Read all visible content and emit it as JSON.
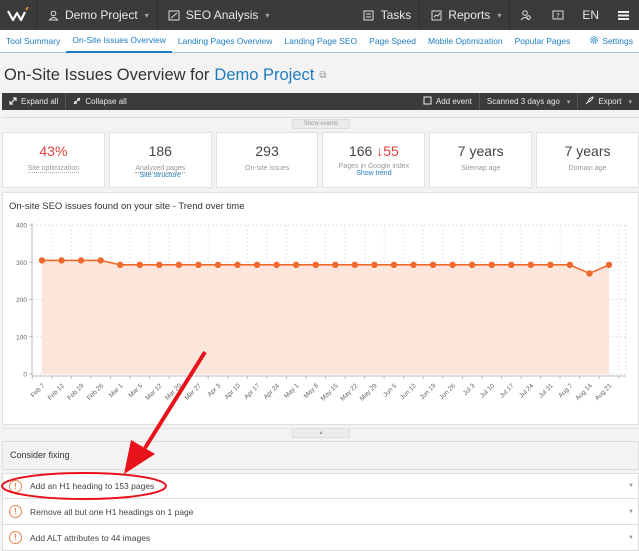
{
  "topbar": {
    "project": "Demo Project",
    "module": "SEO Analysis",
    "tasks": "Tasks",
    "reports": "Reports",
    "language": "EN"
  },
  "subnav": {
    "tabs": [
      {
        "label": "Tool Summary"
      },
      {
        "label": "On-Site Issues Overview"
      },
      {
        "label": "Landing Pages Overview"
      },
      {
        "label": "Landing Page SEO"
      },
      {
        "label": "Page Speed"
      },
      {
        "label": "Mobile Optimization"
      },
      {
        "label": "Popular Pages"
      }
    ],
    "active_index": 1,
    "settings": "Settings"
  },
  "page": {
    "title_prefix": "On-Site Issues Overview for",
    "project_link": "Demo Project"
  },
  "toolbar": {
    "expand_all": "Expand all",
    "collapse_all": "Collapse all",
    "add_event": "Add event",
    "scanned": "Scanned 3 days ago",
    "export": "Export"
  },
  "show_events": "Show events",
  "cards": [
    {
      "value": "43%",
      "label": "Site optimization"
    },
    {
      "value": "186",
      "label": "Analyzed pages",
      "link": "Site structure"
    },
    {
      "value": "293",
      "label": "On-site issues"
    },
    {
      "value": "166",
      "delta": "55",
      "label": "Pages in Google index",
      "link": "Show trend"
    },
    {
      "value": "7 years",
      "label": "Sitemap age"
    },
    {
      "value": "7 years",
      "label": "Domain age"
    }
  ],
  "chart_data": {
    "type": "area",
    "title": "On-site SEO issues found on your site - Trend over time",
    "xlabel": "",
    "ylabel": "",
    "ylim": [
      0,
      400
    ],
    "yticks": [
      0,
      100,
      200,
      300,
      400
    ],
    "grid": true,
    "x": [
      "Feb 7",
      "Feb 12",
      "Feb 19",
      "Feb 26",
      "Mar 1",
      "Mar 5",
      "Mar 12",
      "Mar 20",
      "Mar 27",
      "Apr 3",
      "Apr 10",
      "Apr 17",
      "Apr 24",
      "May 1",
      "May 8",
      "May 15",
      "May 22",
      "May 29",
      "Jun 5",
      "Jun 12",
      "Jun 19",
      "Jun 26",
      "Jul 3",
      "Jul 10",
      "Jul 17",
      "Jul 24",
      "Jul 31",
      "Aug 7",
      "Aug 14",
      "Aug 21"
    ],
    "series": [
      {
        "name": "On-site issues",
        "color": "#ee6a2c",
        "values": [
          305,
          305,
          305,
          305,
          293,
          293,
          293,
          293,
          293,
          293,
          293,
          293,
          293,
          293,
          293,
          293,
          293,
          293,
          293,
          293,
          293,
          293,
          293,
          293,
          293,
          293,
          293,
          293,
          270,
          293
        ]
      }
    ]
  },
  "consider_fixing": "Consider fixing",
  "issues": [
    {
      "text": "Add an H1 heading to 153 pages"
    },
    {
      "text": "Remove all but one H1 headings on 1 page"
    },
    {
      "text": "Add ALT attributes to 44 images"
    }
  ],
  "colors": {
    "accent": "#1e7dc1",
    "dark_bar": "#3b3b3b",
    "danger": "#e0403a",
    "series": "#ee6a2c",
    "annotation": "#e8121a"
  }
}
